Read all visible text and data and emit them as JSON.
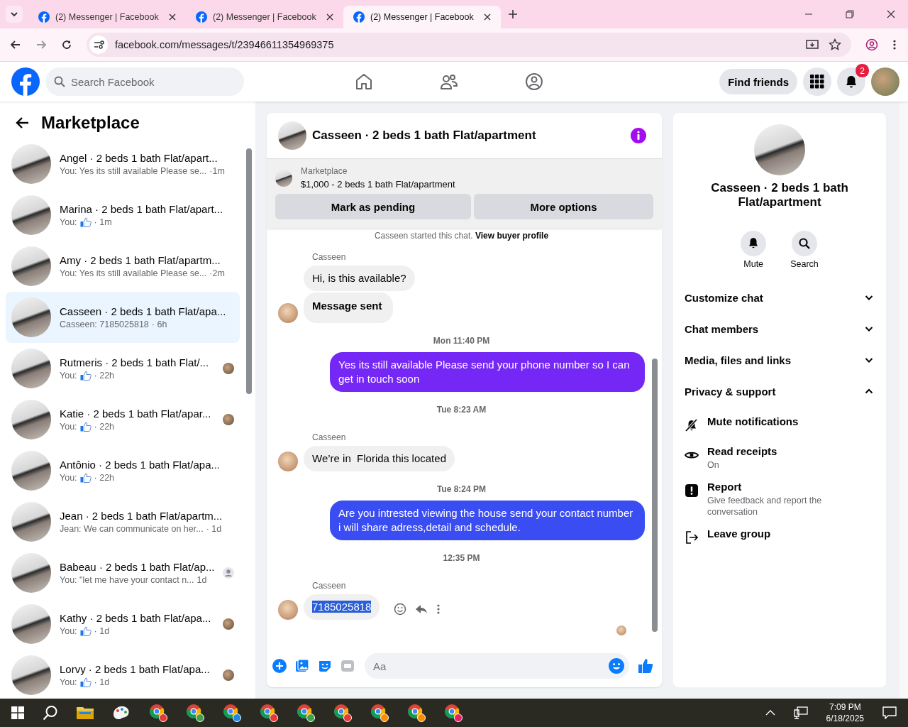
{
  "browser": {
    "tabs": [
      {
        "title": "(2) Messenger | Facebook",
        "selected": false
      },
      {
        "title": "(2) Messenger | Facebook",
        "selected": false
      },
      {
        "title": "(2) Messenger | Facebook",
        "selected": true
      }
    ],
    "url": "facebook.com/messages/t/23946611354969375"
  },
  "nav": {
    "search_placeholder": "Search Facebook",
    "find_friends": "Find friends",
    "notification_count": "2"
  },
  "sidebar": {
    "title": "Marketplace",
    "items": [
      {
        "title": "Angel · 2 beds 1 bath Flat/apart...",
        "preview": "You: Yes its still available Please se...",
        "like": false,
        "time": "·1m",
        "selected": false
      },
      {
        "title": "Marina · 2 beds 1 bath Flat/apart...",
        "preview": "You:",
        "like": true,
        "time": "· 1m",
        "selected": false
      },
      {
        "title": "Amy · 2 beds 1 bath Flat/apartm...",
        "preview": "You: Yes its still available Please se...",
        "like": false,
        "time": "·2m",
        "selected": false
      },
      {
        "title": "Casseen · 2 beds 1 bath Flat/apa...",
        "preview": "Casseen: 7185025818",
        "like": false,
        "time": "· 6h",
        "selected": true
      },
      {
        "title": "Rutmeris · 2 beds 1 bath Flat/...",
        "preview": "You:",
        "like": true,
        "time": "· 22h",
        "selected": false,
        "receipt": {
          "kind": "photo"
        }
      },
      {
        "title": "Katie · 2 beds 1 bath Flat/apar...",
        "preview": "You:",
        "like": true,
        "time": "· 22h",
        "selected": false,
        "receipt": {
          "kind": "photo"
        }
      },
      {
        "title": "Antônio · 2 beds 1 bath Flat/apa...",
        "preview": "You:",
        "like": true,
        "time": "· 22h",
        "selected": false
      },
      {
        "title": "Jean · 2 beds 1 bath Flat/apartm...",
        "preview": "Jean: We can communicate on her...",
        "like": false,
        "time": "· 1d",
        "selected": false
      },
      {
        "title": "Babeau · 2 beds 1 bath Flat/ap...",
        "preview": "You: \"let me have your contact n...",
        "like": false,
        "time": "1d",
        "selected": false,
        "receipt": {
          "kind": "generic"
        }
      },
      {
        "title": "Kathy · 2 beds 1 bath Flat/apa...",
        "preview": "You:",
        "like": true,
        "time": "· 1d",
        "selected": false,
        "receipt": {
          "kind": "photo"
        }
      },
      {
        "title": "Lorvy · 2 beds 1 bath Flat/apa...",
        "preview": "You:",
        "like": true,
        "time": "· 1d",
        "selected": false,
        "receipt": {
          "kind": "photo"
        }
      }
    ]
  },
  "chat": {
    "title": "Casseen · 2 beds 1 bath Flat/apartment",
    "listing": {
      "label": "Marketplace",
      "price_title": "$1,000 - 2 beds 1 bath Flat/apartment",
      "buttons": [
        "Mark as pending",
        "More options"
      ]
    },
    "messages": [
      {
        "kind": "system",
        "text": "Casseen started this chat.",
        "link": "View buyer profile"
      },
      {
        "kind": "sender",
        "text": "Casseen"
      },
      {
        "kind": "in",
        "text": "Hi, is this available?",
        "avatar": false,
        "bold": false,
        "highlighted": false
      },
      {
        "kind": "in",
        "text": "Message sent",
        "avatar": true,
        "bold": true,
        "highlighted": false
      },
      {
        "kind": "time",
        "text": "Mon 11:40 PM"
      },
      {
        "kind": "out",
        "text": "Yes its still available Please send your phone number so I can get in touch soon",
        "color": "#7528f5"
      },
      {
        "kind": "time",
        "text": "Tue 8:23 AM"
      },
      {
        "kind": "sender",
        "text": "Casseen"
      },
      {
        "kind": "in",
        "text": "We’re in  Florida this located",
        "avatar": true,
        "bold": false,
        "highlighted": false
      },
      {
        "kind": "time",
        "text": "Tue 8:24 PM"
      },
      {
        "kind": "out",
        "text": "Are you intrested viewing the house send your contact number i will share adress,detail and schedule.",
        "color": "#3a4df3"
      },
      {
        "kind": "time",
        "text": "12:35 PM"
      },
      {
        "kind": "sender",
        "text": "Casseen"
      },
      {
        "kind": "in",
        "text": "7185025818",
        "avatar": true,
        "bold": false,
        "highlighted": true
      }
    ],
    "seen": true,
    "composer_placeholder": "Aa"
  },
  "details": {
    "title": "Casseen · 2 beds 1 bath Flat/apartment",
    "actions": [
      {
        "kind": "bell",
        "label": "Mute"
      },
      {
        "kind": "search",
        "label": "Search"
      }
    ],
    "sections": [
      {
        "label": "Customize chat",
        "expanded": false
      },
      {
        "label": "Chat members",
        "expanded": false
      },
      {
        "label": "Media, files and links",
        "expanded": false
      },
      {
        "label": "Privacy & support",
        "expanded": true
      }
    ],
    "items": [
      {
        "kind": "mute",
        "title": "Mute notifications"
      },
      {
        "kind": "eye",
        "title": "Read receipts",
        "subtitle": "On"
      },
      {
        "kind": "report",
        "title": "Report",
        "subtitle": "Give feedback and report the conversation"
      },
      {
        "kind": "leave",
        "title": "Leave group"
      }
    ]
  },
  "taskbar": {
    "time": "7:09 PM",
    "date": "6/18/2025"
  }
}
